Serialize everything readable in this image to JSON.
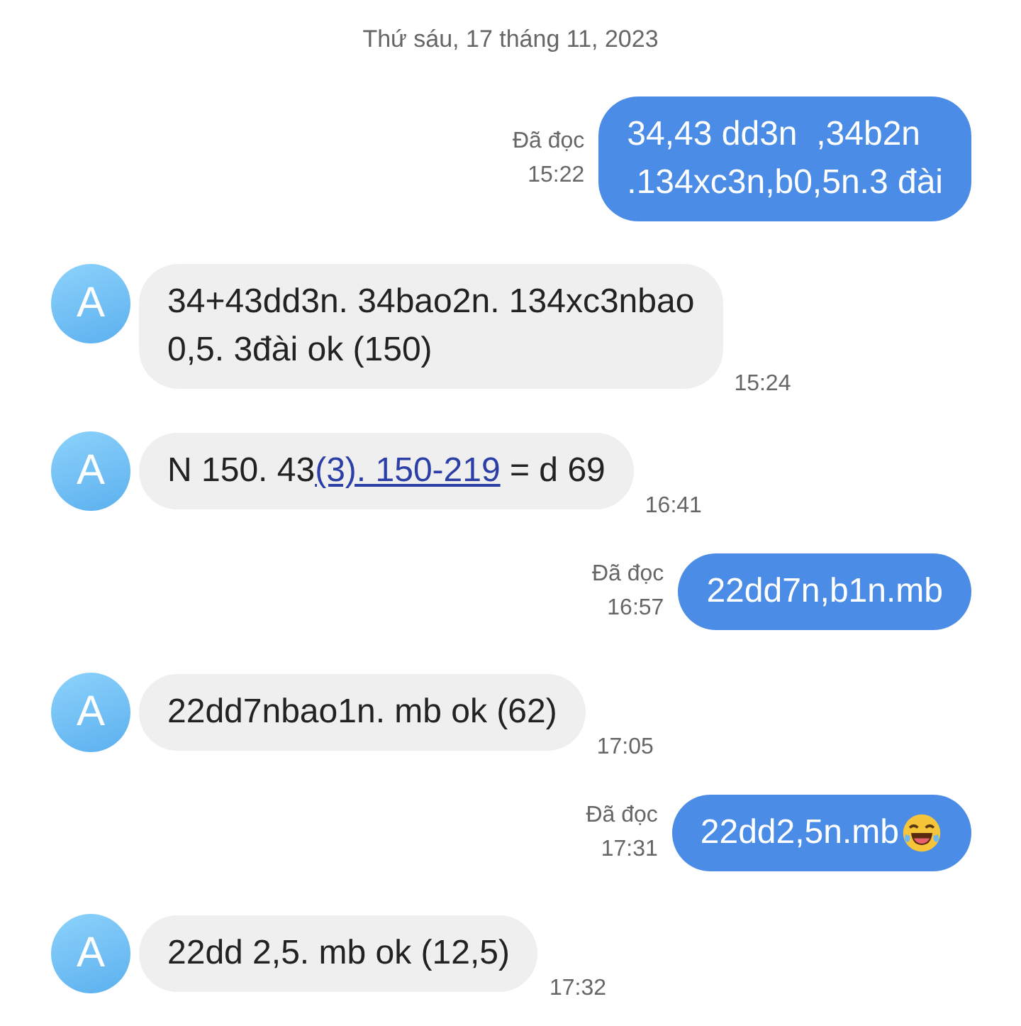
{
  "date_header": "Thứ sáu, 17 tháng 11, 2023",
  "messages": [
    {
      "kind": "sent",
      "status": "Đã đọc",
      "time": "15:22",
      "lines": [
        [
          {
            "kind": "text",
            "text": "34,43 dd3n  ,34b2n"
          }
        ],
        [
          {
            "kind": "text",
            "text": ".134xc3n,b0,5n.3 đài"
          }
        ]
      ]
    },
    {
      "kind": "received",
      "avatar": "A",
      "time": "15:24",
      "lines": [
        [
          {
            "kind": "text",
            "text": "34+43dd3n. 34bao2n. 134xc3nbao"
          }
        ],
        [
          {
            "kind": "text",
            "text": "0,5. 3đài ok (150)"
          }
        ]
      ]
    },
    {
      "kind": "received",
      "avatar": "A",
      "time": "16:41",
      "lines": [
        [
          {
            "kind": "text",
            "text": "N 150. 43"
          },
          {
            "kind": "link",
            "text": "(3). 150-219"
          },
          {
            "kind": "text",
            "text": " = d 69"
          }
        ]
      ]
    },
    {
      "kind": "sent",
      "status": "Đã đọc",
      "time": "16:57",
      "lines": [
        [
          {
            "kind": "text",
            "text": "22dd7n,b1n.mb"
          }
        ]
      ]
    },
    {
      "kind": "received",
      "avatar": "A",
      "time": "17:05",
      "lines": [
        [
          {
            "kind": "text",
            "text": "22dd7nbao1n. mb ok (62)"
          }
        ]
      ]
    },
    {
      "kind": "sent",
      "status": "Đã đọc",
      "time": "17:31",
      "lines": [
        [
          {
            "kind": "text",
            "text": "22dd2,5n.mb"
          },
          {
            "kind": "emoji"
          }
        ]
      ]
    },
    {
      "kind": "received",
      "avatar": "A",
      "time": "17:32",
      "lines": [
        [
          {
            "kind": "text",
            "text": "22dd 2,5. mb ok (12,5)"
          }
        ]
      ]
    }
  ]
}
